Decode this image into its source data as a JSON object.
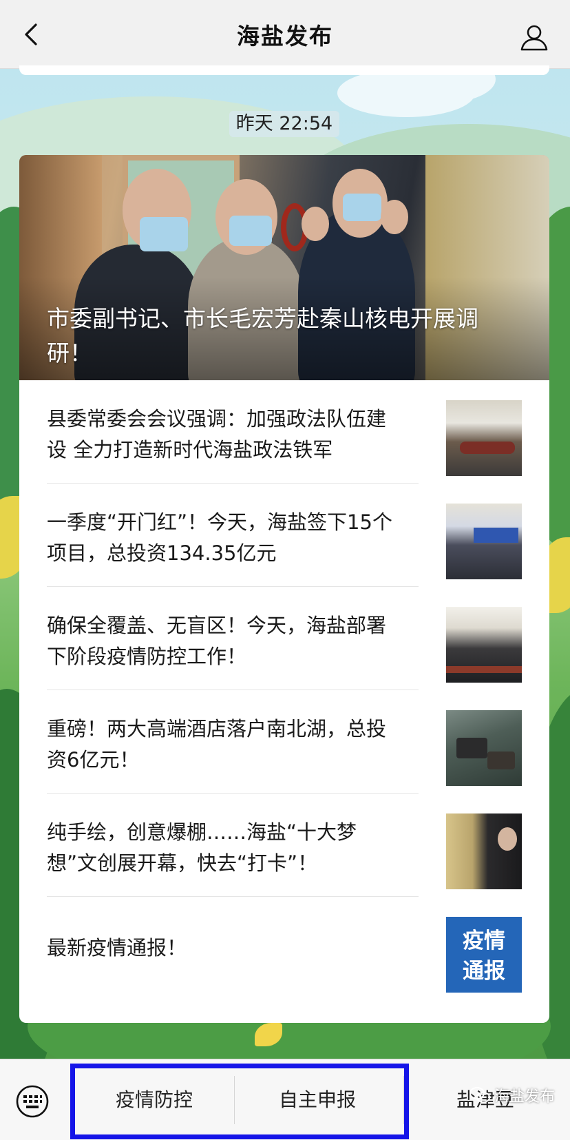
{
  "header": {
    "title": "海盐发布",
    "back_icon": "chevron-left-icon",
    "profile_icon": "person-icon"
  },
  "timestamp": "昨天 22:54",
  "cover_article": {
    "title": "市委副书记、市长毛宏芳赴秦山核电开展调研！"
  },
  "articles": [
    {
      "title": "县委常委会会议强调：加强政法队伍建设 全力打造新时代海盐政法铁军"
    },
    {
      "title": "一季度“开门红”！今天，海盐签下15个项目，总投资134.35亿元"
    },
    {
      "title": "确保全覆盖、无盲区！今天，海盐部署下阶段疫情防控工作！"
    },
    {
      "title": "重磅！两大高端酒店落户南北湖，总投资6亿元！"
    },
    {
      "title": "纯手绘，创意爆棚……海盐“十大梦想”文创展开幕，快去“打卡”！"
    },
    {
      "title": "最新疫情通报！",
      "thumb_text_line1": "疫情",
      "thumb_text_line2": "通报"
    }
  ],
  "menu": {
    "keyboard_icon": "keyboard-icon",
    "items": [
      {
        "label": "疫情防控"
      },
      {
        "label": "自主申报"
      },
      {
        "label": "盐津豆"
      }
    ],
    "highlight_color": "#1515e8"
  },
  "watermark": {
    "icon": "wechat-icon",
    "text": "海盐发布"
  },
  "colors": {
    "accent_blue": "#2466b8",
    "header_bg": "#f1f1f1"
  }
}
